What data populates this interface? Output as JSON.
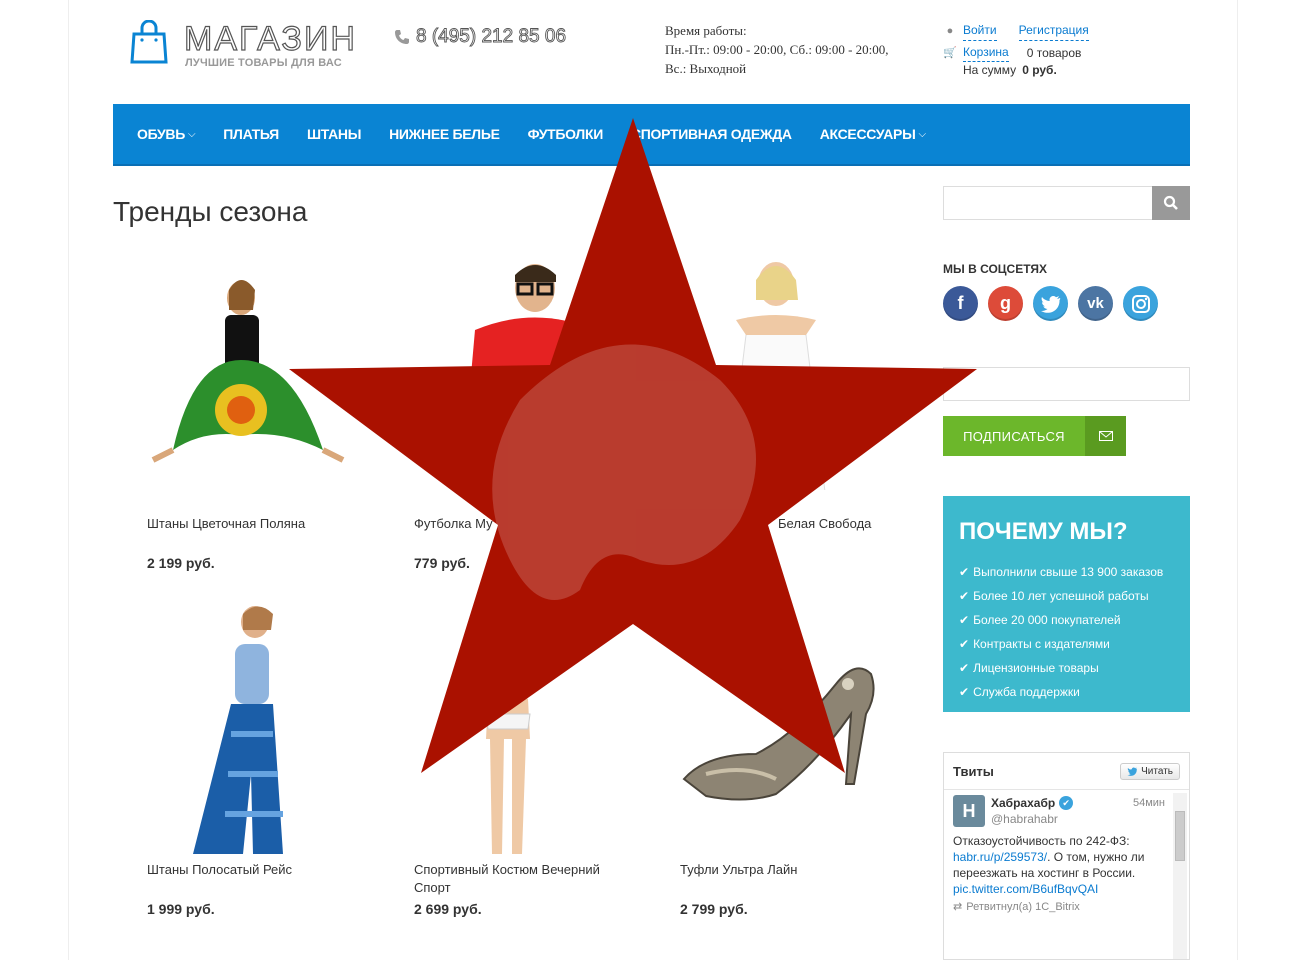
{
  "header": {
    "logo_title": "МАГАЗИН",
    "logo_subtitle": "ЛУЧШИЕ ТОВАРЫ ДЛЯ ВАС",
    "phone": "8 (495) 212 85 06",
    "hours_line1": "Время работы:",
    "hours_line2": "Пн.-Пт.: 09:00 - 20:00, Сб.: 09:00 - 20:00,",
    "hours_line3": "Вс.: Выходной",
    "login": "Войти",
    "register": "Регистрация",
    "cart": "Корзина",
    "cart_count": "0 товаров",
    "cart_sum_label": "На сумму",
    "cart_sum": "0 руб."
  },
  "nav": {
    "items": [
      {
        "label": "ОБУВЬ",
        "has_dropdown": true
      },
      {
        "label": "ПЛАТЬЯ",
        "has_dropdown": false
      },
      {
        "label": "ШТАНЫ",
        "has_dropdown": false
      },
      {
        "label": "НИЖНЕЕ БЕЛЬЕ",
        "has_dropdown": false
      },
      {
        "label": "ФУТБОЛКИ",
        "has_dropdown": false
      },
      {
        "label": "СПОРТИВНАЯ ОДЕЖДА",
        "has_dropdown": false
      },
      {
        "label": "АКСЕССУАРЫ",
        "has_dropdown": true
      }
    ],
    "chevron": "⌵"
  },
  "main": {
    "title": "Тренды сезона",
    "products": [
      {
        "name": "Штаны Цветочная Поляна",
        "price": "2 199 руб."
      },
      {
        "name": "Футболка Му",
        "price": "779 руб."
      },
      {
        "name": "Белая Свобода",
        "price": ""
      },
      {
        "name": "Штаны Полосатый Рейс",
        "price": "1 999 руб."
      },
      {
        "name": "Спортивный Костюм Вечерний Спорт",
        "price": "2 699 руб."
      },
      {
        "name": "Туфли Ультра Лайн",
        "price": "2 799 руб."
      }
    ]
  },
  "sidebar": {
    "social_title": "МЫ В СОЦСЕТЯХ",
    "social": [
      {
        "name": "facebook-icon",
        "glyph": "f",
        "color": "#3b5998"
      },
      {
        "name": "google-plus-icon",
        "glyph": "g",
        "color": "#dd4b39"
      },
      {
        "name": "twitter-icon",
        "glyph": "t",
        "color": "#3aa3dd"
      },
      {
        "name": "vk-icon",
        "glyph": "vk",
        "color": "#4c75a3"
      },
      {
        "name": "instagram-icon",
        "glyph": "◎",
        "color": "#3aa3dd"
      }
    ],
    "subscribe_label": "ПОДПИСАТЬСЯ",
    "why_title": "ПОЧЕМУ МЫ?",
    "why_items": [
      "Выполнили свыше 13 900 заказов",
      "Более 10 лет успешной работы",
      "Более 20 000 покупателей",
      "Контракты с издателями",
      "Лицензионные товары",
      "Служба поддержки"
    ],
    "tweets": {
      "title": "Твиты",
      "follow": "Читать",
      "author": "Хабрахабр",
      "handle": "@habrahabr",
      "time": "54мин",
      "text1": "Отказоустойчивость по 242-ФЗ:",
      "link1": "habr.ru/p/259573/",
      "text2": ". О том, нужно ли переезжать на хостинг в России.",
      "link2": "pic.twitter.com/B6ufBqvQAI",
      "retweet": "Ретвитнул(а) 1C_Bitrix"
    }
  },
  "colors": {
    "nav": "#0a84d3",
    "subscribe": "#6cb72b",
    "why": "#3db9cd",
    "star": "#aa1100"
  }
}
